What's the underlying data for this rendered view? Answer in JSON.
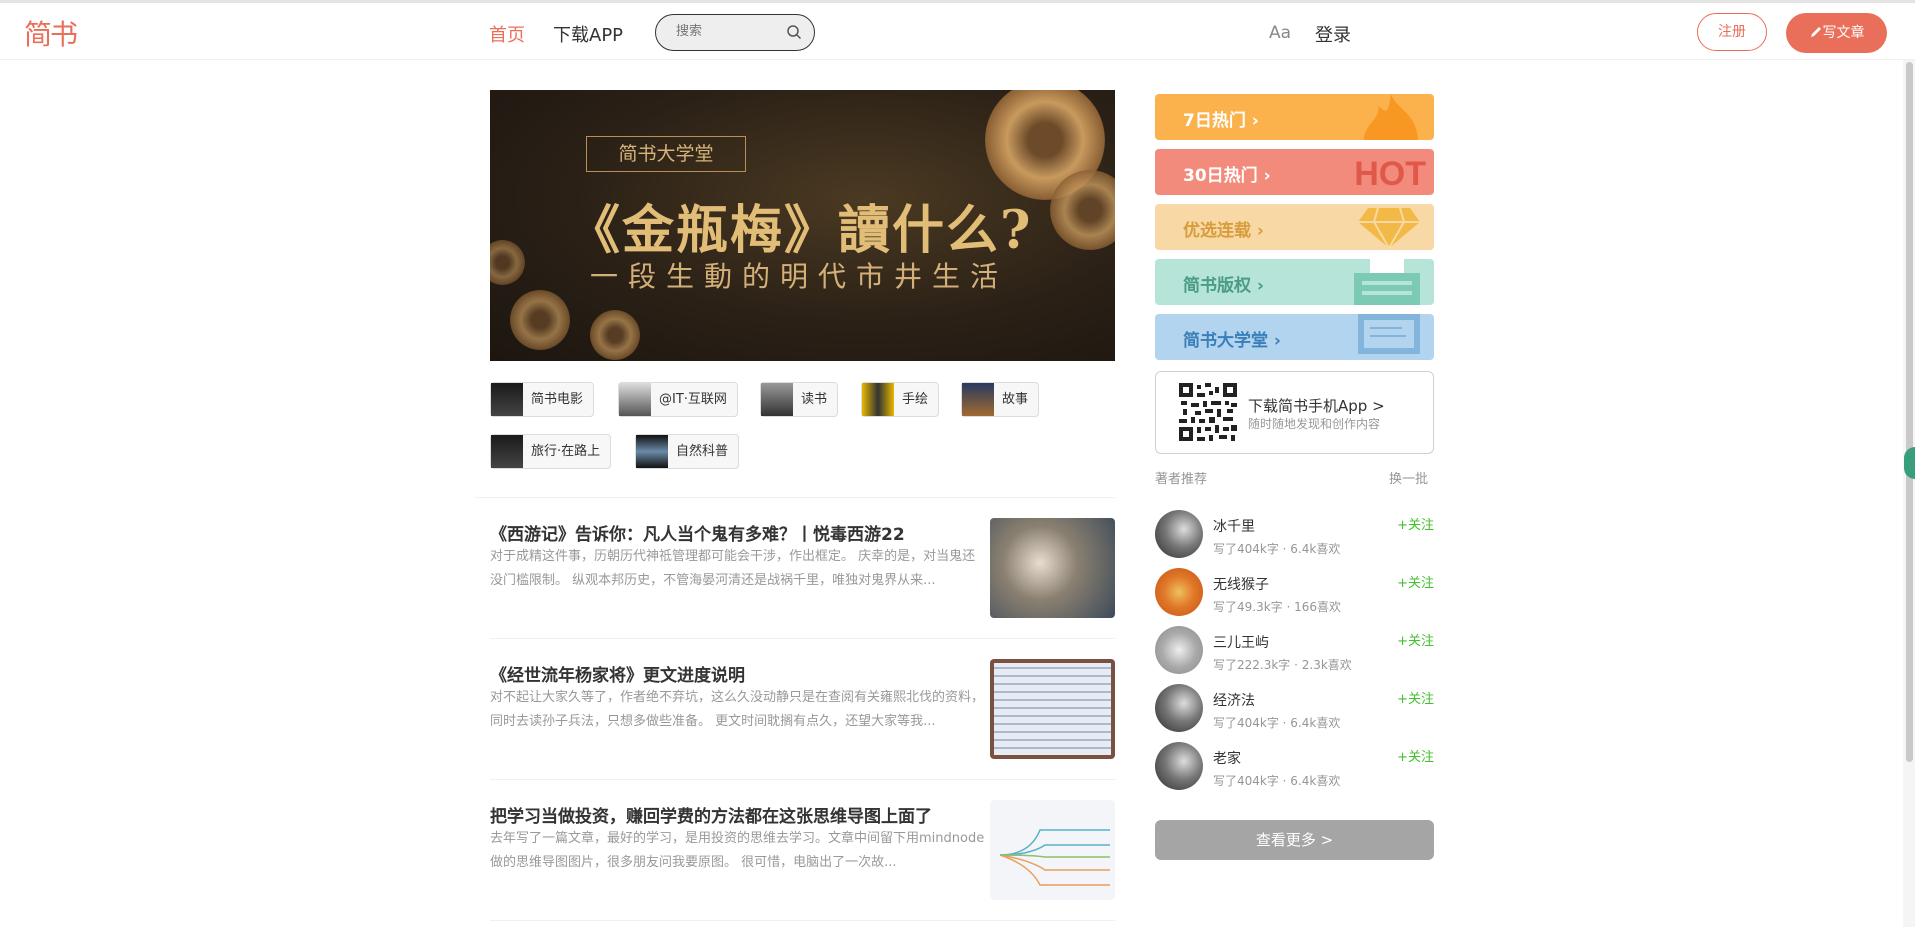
{
  "header": {
    "logo": "简书",
    "nav_home": "首页",
    "nav_app": "下载APP",
    "search_placeholder": "搜索",
    "font_toggle": "Aa",
    "login": "登录",
    "register": "注册",
    "write": "写文章"
  },
  "banner": {
    "box": "简书大学堂",
    "title": "《金瓶梅》讀什么?",
    "subtitle": "一段生動的明代市井生活"
  },
  "collections": [
    {
      "label": "简书电影"
    },
    {
      "label": "@IT·互联网"
    },
    {
      "label": "读书"
    },
    {
      "label": "手绘"
    },
    {
      "label": "故事"
    },
    {
      "label": "旅行·在路上"
    },
    {
      "label": "自然科普"
    }
  ],
  "articles": [
    {
      "title": "《西游记》告诉你：凡人当个鬼有多难？丨悦毒西游22",
      "abstract": "对于成精这件事，历朝历代神祗管理都可能会干涉，作出框定。 庆幸的是，对当鬼还没门槛限制。 纵观本邦历史，不管海晏河清还是战祸千里，唯独对鬼界从来..."
    },
    {
      "title": "《经世流年杨家将》更文进度说明",
      "abstract": "对不起让大家久等了，作者绝不弃坑，这么久没动静只是在查阅有关雍熙北伐的资料，同时去读孙子兵法，只想多做些准备。 更文时间耽搁有点久，还望大家等我..."
    },
    {
      "title": "把学习当做投资，赚回学费的方法都在这张思维导图上面了",
      "abstract": "去年写了一篇文章，最好的学习，是用投资的思维去学习。文章中间留下用mindnode做的思维导图图片，很多朋友问我要原图。 很可惜，电脑出了一次故..."
    }
  ],
  "boards": [
    {
      "label": "7日热门 ›",
      "color": "#fbb24c"
    },
    {
      "label": "30日热门 ›",
      "color": "#f28b7c"
    },
    {
      "label": "优选连载 ›",
      "color": "#f8d9a6"
    },
    {
      "label": "简书版权 ›",
      "color": "#b6e4d8"
    },
    {
      "label": "简书大学堂 ›",
      "color": "#b3d4ee"
    }
  ],
  "download": {
    "title": "下载简书手机App >",
    "subtitle": "随时随地发现和创作内容"
  },
  "recommend": {
    "title": "著者推荐",
    "switch": "换一批",
    "follow": "+关注",
    "authors": [
      {
        "name": "冰千里",
        "meta": "写了404k字 · 6.4k喜欢"
      },
      {
        "name": "无线猴子",
        "meta": "写了49.3k字 · 166喜欢"
      },
      {
        "name": "三儿王屿",
        "meta": "写了222.3k字 · 2.3k喜欢"
      },
      {
        "name": "经济法",
        "meta": "写了404k字 · 6.4k喜欢"
      },
      {
        "name": "老家",
        "meta": "写了404k字 · 6.4k喜欢"
      }
    ],
    "more": "查看更多 >"
  },
  "colors": {
    "accent": "#ea6f5a",
    "follow": "#42c02e"
  }
}
